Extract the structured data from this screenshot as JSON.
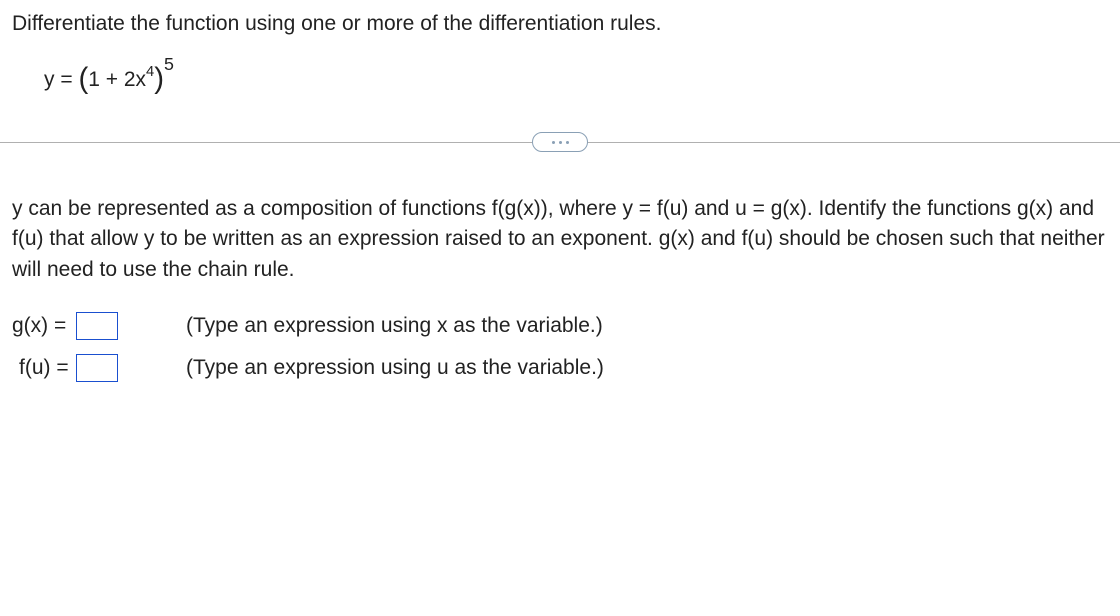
{
  "prompt": "Differentiate the function using one or more of the differentiation rules.",
  "equation": {
    "y_eq": "y = ",
    "open": "(",
    "inner_a": "1 + 2x",
    "inner_exp": "4",
    "close": ")",
    "outer_exp": "5"
  },
  "question_text": "y can be represented as a composition of functions f(g(x)), where y = f(u) and u = g(x). Identify the functions g(x) and f(u) that allow y to be written as an expression raised to an exponent. g(x) and f(u) should be chosen such that neither will need to use the chain rule.",
  "answers": {
    "gx": {
      "label": "g(x) = ",
      "value": "",
      "hint": "(Type an expression using x as the variable.)"
    },
    "fu": {
      "label": "f(u) = ",
      "value": "",
      "hint": "(Type an expression using u as the variable.)"
    }
  }
}
